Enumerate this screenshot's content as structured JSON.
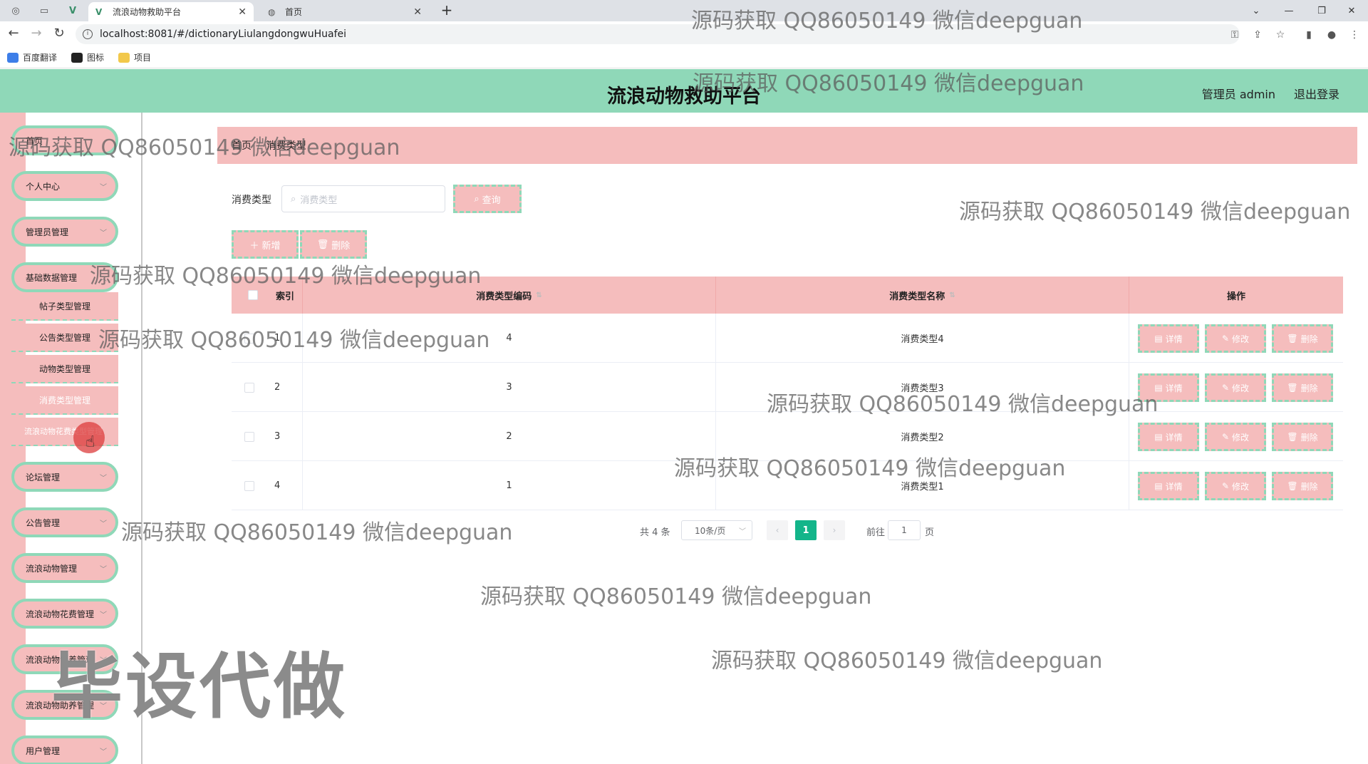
{
  "browser": {
    "tabs": [
      {
        "title": "流浪动物救助平台",
        "active": true
      },
      {
        "title": "首页",
        "active": false
      }
    ],
    "url": "localhost:8081/#/dictionaryLiulangdongwuHuafei",
    "bookmarks": [
      "百度翻译",
      "图标",
      "项目"
    ]
  },
  "header": {
    "title": "流浪动物救助平台",
    "user": "管理员 admin",
    "logout": "退出登录",
    "color": "#8fd8b8"
  },
  "sidebar": {
    "items": [
      {
        "label": "首页",
        "expandable": false
      },
      {
        "label": "个人中心",
        "expandable": true
      },
      {
        "label": "管理员管理",
        "expandable": true
      },
      {
        "label": "基础数据管理",
        "expandable": true
      },
      {
        "label": "论坛管理",
        "expandable": true
      },
      {
        "label": "公告管理",
        "expandable": true
      },
      {
        "label": "流浪动物管理",
        "expandable": true
      },
      {
        "label": "流浪动物花费管理",
        "expandable": true
      },
      {
        "label": "流浪动物领养管理",
        "expandable": true
      },
      {
        "label": "流浪动物助养管理",
        "expandable": true
      },
      {
        "label": "用户管理",
        "expandable": true
      }
    ],
    "sub_items": [
      "帖子类型管理",
      "公告类型管理",
      "动物类型管理",
      "消费类型管理",
      "流浪动物花费类型管理"
    ],
    "accent": "#f5bdbd"
  },
  "breadcrumb": [
    "首页",
    "消费类型"
  ],
  "search": {
    "label": "消费类型",
    "placeholder": "消费类型",
    "button": "查询"
  },
  "actions": {
    "add": "新增",
    "delete": "删除"
  },
  "table": {
    "columns": [
      "索引",
      "消费类型编码",
      "消费类型名称",
      "操作"
    ],
    "rows": [
      {
        "index": "1",
        "code": "4",
        "name": "消费类型4"
      },
      {
        "index": "2",
        "code": "3",
        "name": "消费类型3"
      },
      {
        "index": "3",
        "code": "2",
        "name": "消费类型2"
      },
      {
        "index": "4",
        "code": "1",
        "name": "消费类型1"
      }
    ],
    "row_actions": {
      "detail": "详情",
      "edit": "修改",
      "delete": "删除"
    }
  },
  "pagination": {
    "total": "共 4 条",
    "page_size": "10条/页",
    "current_page": "1",
    "goto_label": "前往",
    "goto_value": "1",
    "page_unit": "页"
  },
  "watermarks": {
    "repeat_text": "源码获取 QQ86050149 微信deepguan",
    "big_text": "毕设代做"
  }
}
